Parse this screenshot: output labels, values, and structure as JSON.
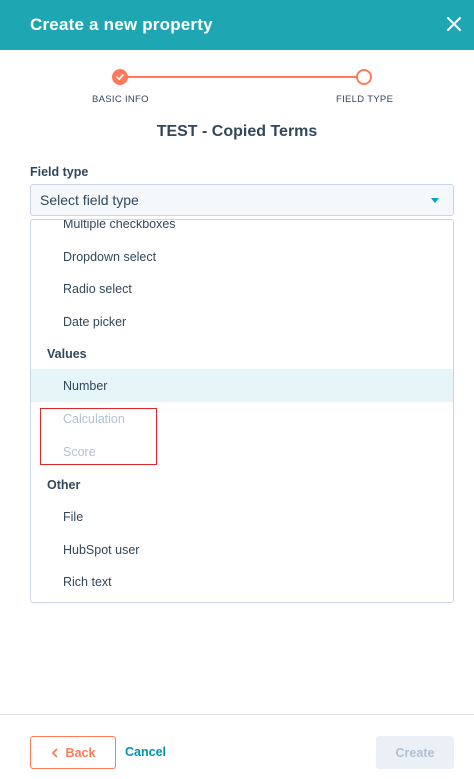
{
  "header": {
    "title": "Create a new property",
    "close_icon": "close-icon"
  },
  "stepper": {
    "steps": [
      {
        "label": "BASIC INFO",
        "state": "complete"
      },
      {
        "label": "FIELD TYPE",
        "state": "current"
      }
    ]
  },
  "page_title": "TEST - Copied Terms",
  "field": {
    "label": "Field type",
    "select_value": "Select field type"
  },
  "dropdown": {
    "items": [
      {
        "label": "Multiple checkboxes",
        "kind": "option"
      },
      {
        "label": "Dropdown select",
        "kind": "option"
      },
      {
        "label": "Radio select",
        "kind": "option"
      },
      {
        "label": "Date picker",
        "kind": "option"
      },
      {
        "label": "Values",
        "kind": "group"
      },
      {
        "label": "Number",
        "kind": "option",
        "hovered": true
      },
      {
        "label": "Calculation",
        "kind": "option",
        "disabled": true
      },
      {
        "label": "Score",
        "kind": "option",
        "disabled": true
      },
      {
        "label": "Other",
        "kind": "group"
      },
      {
        "label": "File",
        "kind": "option"
      },
      {
        "label": "HubSpot user",
        "kind": "option"
      },
      {
        "label": "Rich text",
        "kind": "option"
      }
    ]
  },
  "footer": {
    "back_label": "Back",
    "cancel_label": "Cancel",
    "create_label": "Create"
  },
  "colors": {
    "header_bg": "#1ea7b3",
    "accent": "#ff7a59",
    "link": "#0091ae",
    "hover_bg": "#e5f5f8",
    "highlight": "#e0262b"
  }
}
